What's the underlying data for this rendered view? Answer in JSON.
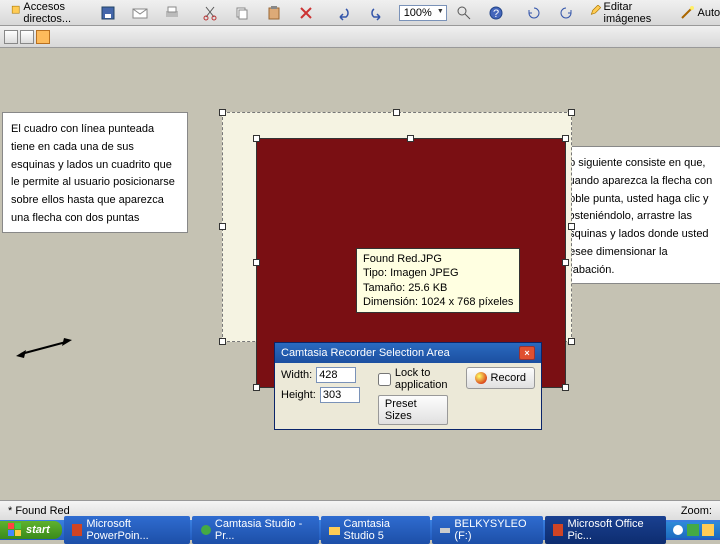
{
  "toolbar": {
    "accesos": "Accesos directos...",
    "zoom": "100%",
    "editar": "Editar imágenes",
    "auto": "Autocorrección"
  },
  "callout_left": "El cuadro con línea punteada tiene en cada una de sus esquinas y lados un cuadrito que le permite al usuario posicionarse sobre ellos hasta que aparezca una flecha con dos puntas",
  "callout_right": "Lo siguiente consiste en que, cuando aparezca la flecha con doble punta, usted haga clic y sosteniéndolo, arrastre las esquinas y lados donde usted desee dimensionar la grabación.",
  "tooltip": {
    "name": "Found Red.JPG",
    "type": "Tipo: Imagen JPEG",
    "size": "Tamaño: 25.6 KB",
    "dim": "Dimensión: 1024 x 768 píxeles"
  },
  "camtasia": {
    "title": "Camtasia Recorder Selection Area",
    "width_label": "Width:",
    "width": "428",
    "height_label": "Height:",
    "height": "303",
    "lock": "Lock to application",
    "preset": "Preset Sizes",
    "record": "Record"
  },
  "status": {
    "left": "* Found Red",
    "zoom": "Zoom:"
  },
  "taskbar": {
    "start": "start",
    "items": [
      {
        "label": "Microsoft PowerPoin..."
      },
      {
        "label": "Camtasia Studio - Pr..."
      },
      {
        "label": "Camtasia Studio 5"
      },
      {
        "label": "BELKYSYLEO (F:)"
      },
      {
        "label": "Microsoft Office Pic..."
      }
    ]
  }
}
